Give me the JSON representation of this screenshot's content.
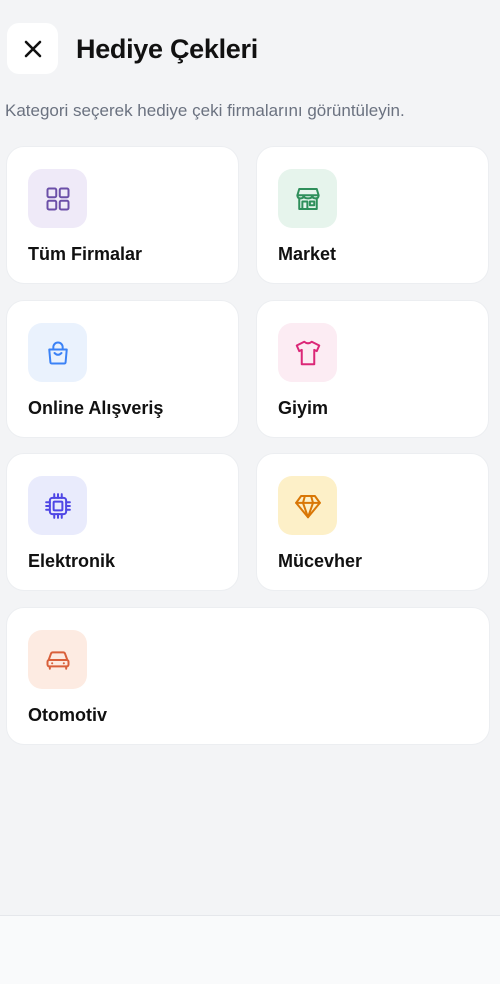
{
  "header": {
    "title": "Hediye Çekleri",
    "close_icon": "close-icon"
  },
  "subtitle": "Kategori seçerek hediye çeki firmalarını görüntüleyin.",
  "categories": [
    {
      "label": "Tüm Firmalar",
      "icon": "grid-icon",
      "color": "#6b4fa8",
      "bg": "#efeaf8"
    },
    {
      "label": "Market",
      "icon": "store-icon",
      "color": "#2f8f5b",
      "bg": "#e6f4ec"
    },
    {
      "label": "Online Alışveriş",
      "icon": "shopping-bag-icon",
      "color": "#3b82f6",
      "bg": "#eaf2fd"
    },
    {
      "label": "Giyim",
      "icon": "shirt-icon",
      "color": "#db2777",
      "bg": "#fcecf3"
    },
    {
      "label": "Elektronik",
      "icon": "cpu-chip-icon",
      "color": "#4f46e5",
      "bg": "#e9ebfc"
    },
    {
      "label": "Mücevher",
      "icon": "diamond-icon",
      "color": "#d97706",
      "bg": "#fdf0c8"
    },
    {
      "label": "Otomotiv",
      "icon": "car-icon",
      "color": "#d9603b",
      "bg": "#fdebe2"
    }
  ]
}
